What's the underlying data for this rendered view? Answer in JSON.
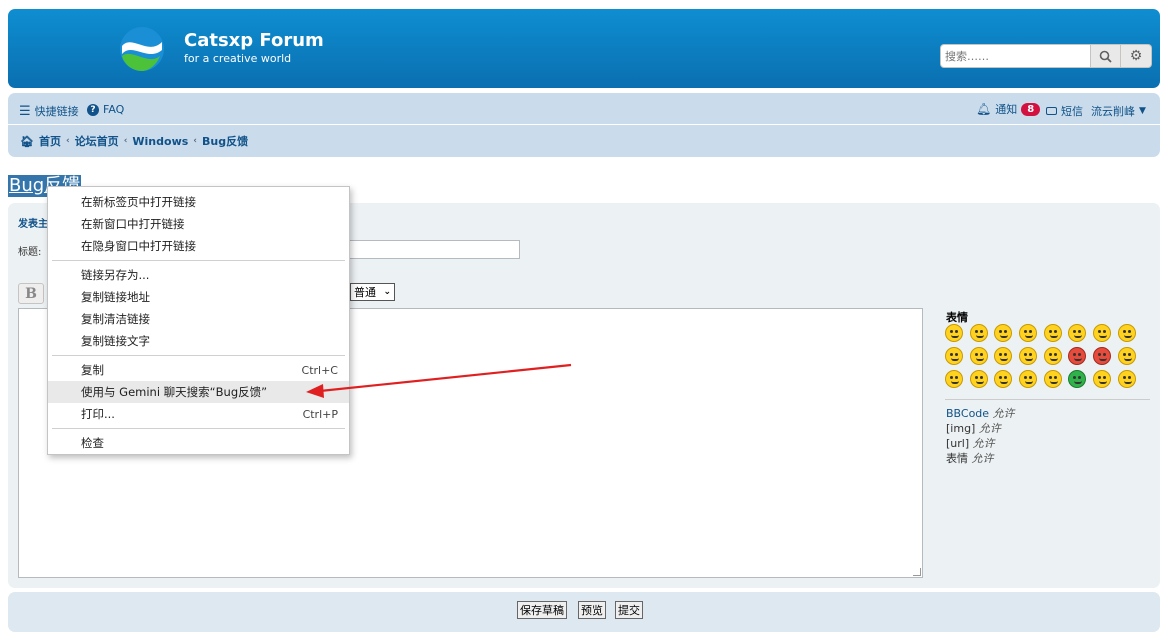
{
  "header": {
    "title": "Catsxp Forum",
    "subtitle": "for a creative world",
    "search_placeholder": "搜索……"
  },
  "nav": {
    "quick_links": "快捷链接",
    "faq": "FAQ",
    "notifications": "通知",
    "notifications_count": "8",
    "messages": "短信",
    "username": "流云削峰"
  },
  "breadcrumb": [
    "首页",
    "论坛首页",
    "Windows",
    "Bug反馈"
  ],
  "page_title": "Bug反馈",
  "form": {
    "heading": "发表主题",
    "subject_label": "标题:",
    "bold_label": "B",
    "font_size_value": "普通"
  },
  "smilies": {
    "title": "表情",
    "rules": [
      {
        "name": "BBCode",
        "status": "允许"
      },
      {
        "name": "[img]",
        "status": "允许"
      },
      {
        "name": "[url]",
        "status": "允许"
      },
      {
        "name": "表情",
        "status": "允许"
      }
    ]
  },
  "buttons": {
    "save_draft": "保存草稿",
    "preview": "预览",
    "submit": "提交"
  },
  "context_menu": {
    "group1": [
      "在新标签页中打开链接",
      "在新窗口中打开链接",
      "在隐身窗口中打开链接"
    ],
    "group2": [
      "链接另存为...",
      "复制链接地址",
      "复制清洁链接",
      "复制链接文字"
    ],
    "copy": "复制",
    "copy_shortcut": "Ctrl+C",
    "gemini": "使用与 Gemini 聊天搜索“Bug反馈”",
    "print": "打印...",
    "print_shortcut": "Ctrl+P",
    "inspect": "检查"
  },
  "colors": {
    "header_blue": "#0e8ed1",
    "nav_bg": "#cadceb",
    "link": "#105289",
    "badge": "#d31141",
    "annotation_arrow": "#e02020"
  }
}
